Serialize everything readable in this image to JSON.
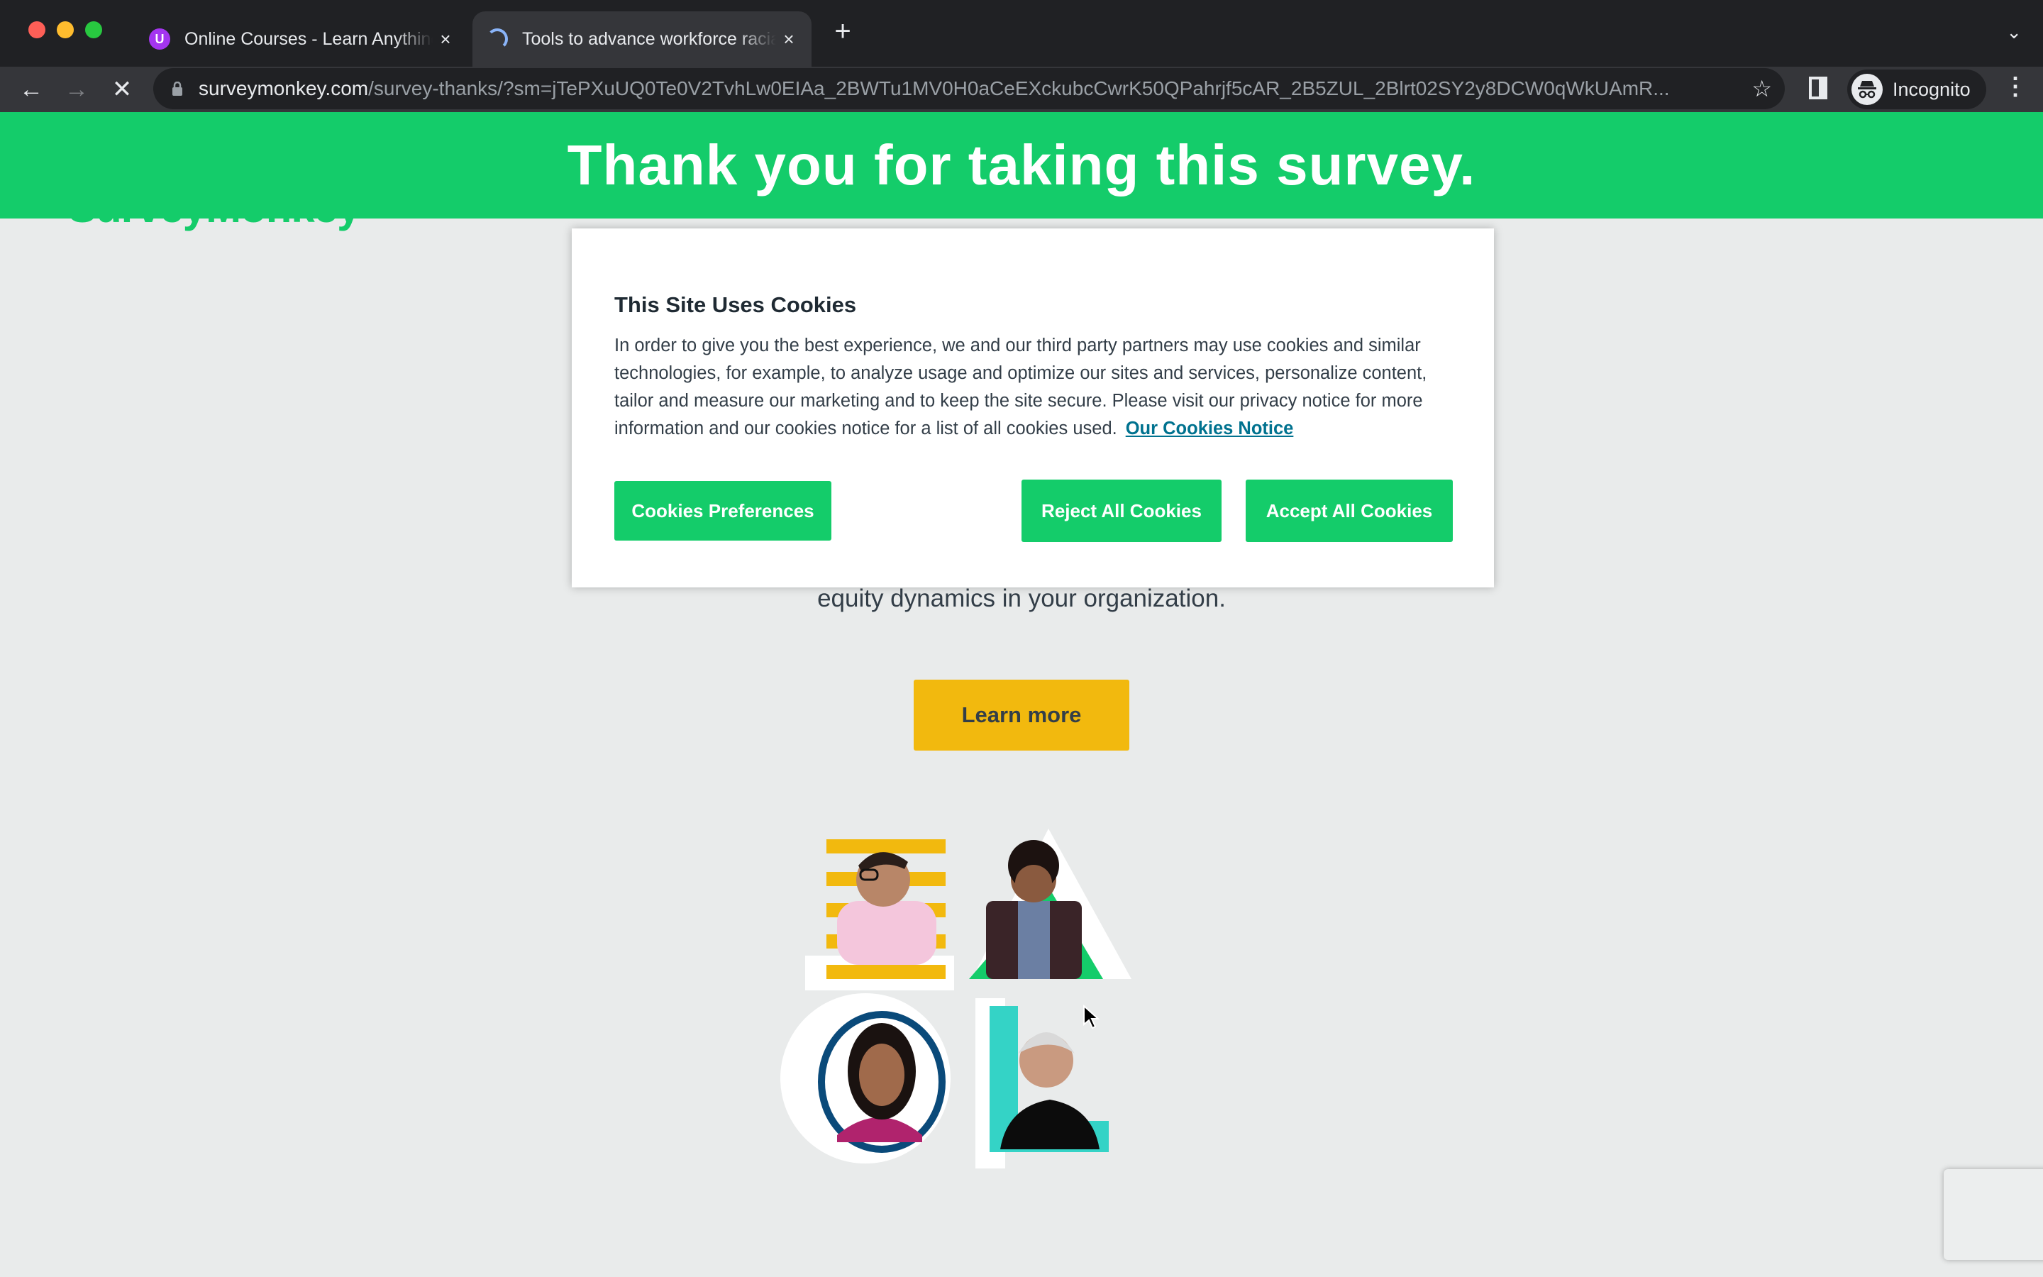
{
  "browser": {
    "tabs": [
      {
        "title": "Online Courses - Learn Anything",
        "favicon": "udemy-icon",
        "active": false
      },
      {
        "title": "Tools to advance workforce racial equity",
        "favicon": "loading-spinner-icon",
        "active": true
      }
    ],
    "close_glyph": "×",
    "new_tab_glyph": "+",
    "tab_list_glyph": "⌄",
    "back_glyph": "←",
    "forward_glyph": "→",
    "stop_glyph": "✕",
    "lock_glyph": "🔒",
    "url_host": "surveymonkey.com",
    "url_path": "/survey-thanks/?sm=jTePXuUQ0Te0V2TvhLw0EIAa_2BWTu1MV0H0aCeEXckubcCwrK50QPahrjf5cAR_2B5ZUL_2Blrt02SY2y8DCW0qWkUAmR...",
    "star_glyph": "☆",
    "profile_label": "Incognito",
    "menu_glyph": "⋮"
  },
  "page": {
    "logo_text": "SurveyMonkey",
    "banner_heading": "Thank you for taking this survey.",
    "subtext": "equity dynamics in your organization.",
    "learn_more_label": "Learn more",
    "brand_green": "#14cc6a",
    "accent_yellow": "#f2b90e"
  },
  "cookie_banner": {
    "title": "This Site Uses Cookies",
    "body": "In order to give you the best experience, we and our third party partners may use cookies and similar technologies, for example, to analyze usage and optimize our sites and services, personalize content, tailor and measure our marketing and to keep the site secure. Please visit our privacy notice for more information and our cookies notice for a list of all cookies used.",
    "link_label": "Our Cookies Notice",
    "buttons": {
      "preferences": "Cookies Preferences",
      "reject": "Reject All Cookies",
      "accept": "Accept All Cookies"
    }
  }
}
